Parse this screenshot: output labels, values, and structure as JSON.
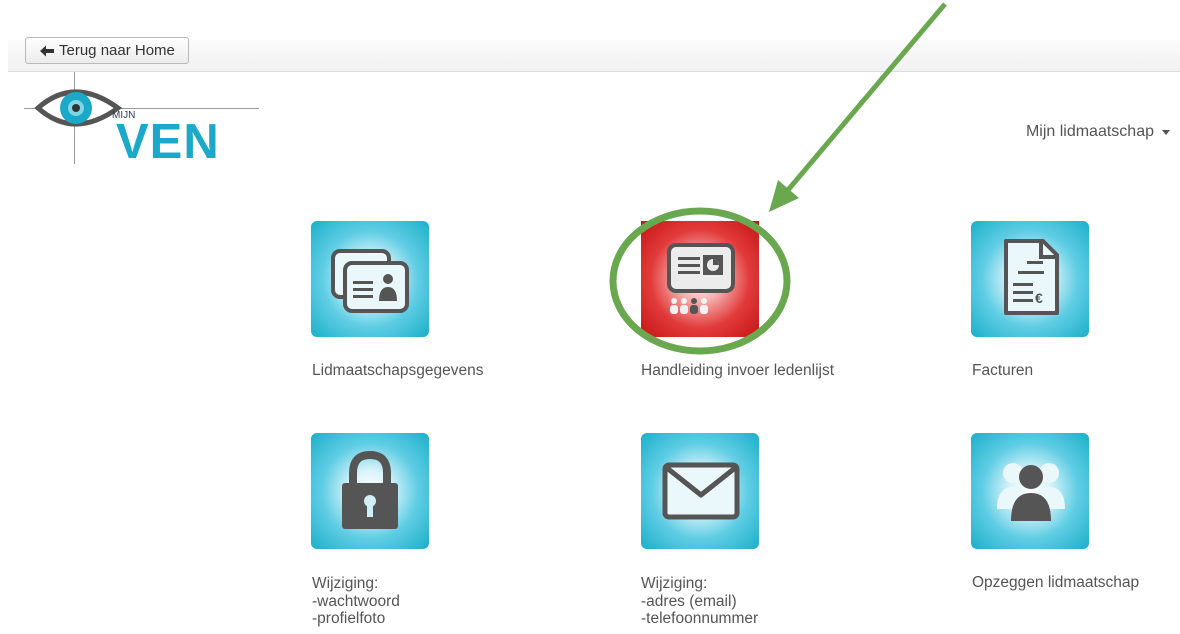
{
  "topbar": {
    "back_label": "Terug naar Home"
  },
  "logo": {
    "small_text": "MIJN",
    "big_text": "VEN"
  },
  "menu": {
    "label": "Mijn lidmaatschap"
  },
  "tiles": [
    {
      "label": "Lidmaatschapsgegevens",
      "icon": "id-cards-icon"
    },
    {
      "label": "Handleiding invoer ledenlijst",
      "icon": "presentation-icon"
    },
    {
      "label": "Facturen",
      "icon": "invoice-icon"
    },
    {
      "label_lines": [
        "Wijziging:",
        "-wachtwoord",
        "-profielfoto"
      ],
      "icon": "lock-icon"
    },
    {
      "label_lines": [
        "Wijziging:",
        "-adres (email)",
        "-telefoonnummer"
      ],
      "icon": "envelope-icon"
    },
    {
      "label": "Opzeggen lidmaatschap",
      "icon": "users-icon"
    }
  ],
  "colors": {
    "tile_blue": "#1bafc9",
    "tile_red": "#d41f1f",
    "annotation_green": "#6aa84f",
    "logo_blue": "#1ca9c9"
  }
}
